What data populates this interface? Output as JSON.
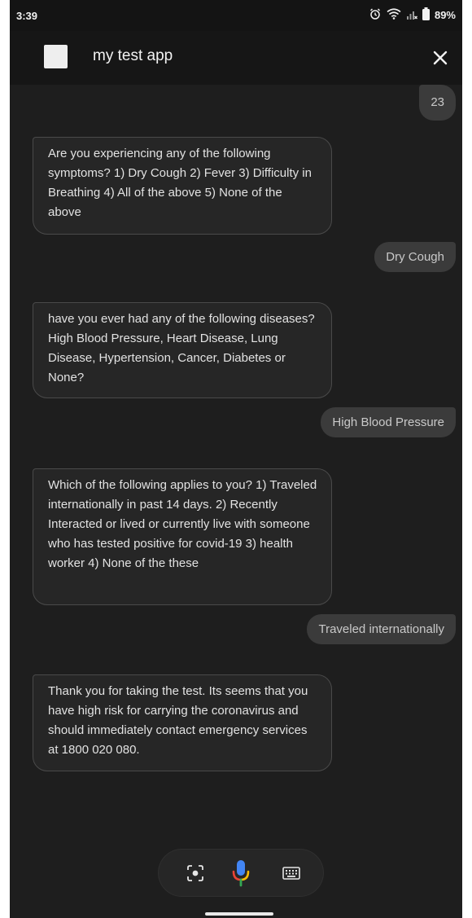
{
  "status_bar": {
    "time": "3:39",
    "battery": "89%",
    "icons": [
      "alarm-icon",
      "wifi-icon",
      "signal-icon",
      "battery-icon"
    ]
  },
  "app_bar": {
    "title": "my test app",
    "logo_icon": "app-logo",
    "close_icon": "close-icon"
  },
  "conversation": [
    {
      "sender": "user",
      "text": "23"
    },
    {
      "sender": "bot",
      "text": "Are you experiencing any of the following symptoms? 1) Dry Cough 2) Fever 3) Difficulty in Breathing 4) All of the above 5) None of the above"
    },
    {
      "sender": "user",
      "text": "Dry Cough"
    },
    {
      "sender": "bot",
      "text": "have you ever had any of the following diseases? High Blood Pressure, Heart Disease, Lung Disease, Hypertension, Cancer, Diabetes or None?"
    },
    {
      "sender": "user",
      "text": "High Blood Pressure"
    },
    {
      "sender": "bot",
      "text": "Which of the following applies to you? 1) Traveled internationally in past 14 days. 2) Recently Interacted or lived or currently live with someone who has tested positive for covid-19 3) health worker 4) None of the these"
    },
    {
      "sender": "user",
      "text": "Traveled internationally"
    },
    {
      "sender": "bot",
      "text": "Thank you for taking the test. Its seems that you have high risk for carrying the coronavirus and should immediately contact emergency services at 1800 020 080."
    }
  ],
  "input_bar": {
    "icons": [
      "lens-icon",
      "mic-icon",
      "keyboard-icon"
    ]
  },
  "colors": {
    "background": "#1e1e1e",
    "app_bar": "#161616",
    "bot_bubble": "#262626",
    "user_bubble": "#3b3b3b",
    "mic_blue": "#4285f4",
    "mic_red": "#ea4335",
    "mic_yellow": "#fbbc05",
    "mic_green": "#34a853"
  }
}
